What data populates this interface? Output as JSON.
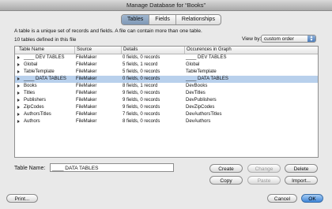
{
  "window": {
    "title": "Manage Database for “Books”"
  },
  "tabs": [
    {
      "label": "Tables",
      "active": true
    },
    {
      "label": "Fields",
      "active": false
    },
    {
      "label": "Relationships",
      "active": false
    }
  ],
  "description": "A table is a unique set of records and fields. A file can contain more than one table.",
  "table_count": "10 tables defined in this file",
  "view_by": {
    "label": "View by:",
    "value": "custom order"
  },
  "table_list": {
    "headers": [
      "Table Name",
      "Source",
      "Details",
      "Occurences in Graph"
    ],
    "rows": [
      {
        "name": "____ DEV TABLES",
        "source": "FileMaker",
        "details": "0 fields, 0 records",
        "occurrences": "____ DEV TABLES",
        "selected": false
      },
      {
        "name": "Global",
        "source": "FileMaker",
        "details": "5 fields, 1 record",
        "occurrences": "Global",
        "selected": false
      },
      {
        "name": "TableTemplate",
        "source": "FileMaker",
        "details": "5 fields, 0 records",
        "occurrences": "TableTemplate",
        "selected": false
      },
      {
        "name": "____ DATA TABLES",
        "source": "FileMaker",
        "details": "0 fields, 0 records",
        "occurrences": "____ DATA TABLES",
        "selected": true
      },
      {
        "name": "Books",
        "source": "FileMaker",
        "details": "8 fields, 1 record",
        "occurrences": "DevBooks",
        "selected": false
      },
      {
        "name": "Titles",
        "source": "FileMaker",
        "details": "9 fields, 0 records",
        "occurrences": "DevTitles",
        "selected": false
      },
      {
        "name": "Publishers",
        "source": "FileMaker",
        "details": "9 fields, 0 records",
        "occurrences": "DevPublishers",
        "selected": false
      },
      {
        "name": "ZipCodes",
        "source": "FileMaker",
        "details": "9 fields, 0 records",
        "occurrences": "DevZipCodes",
        "selected": false
      },
      {
        "name": "AuthorsTitles",
        "source": "FileMaker",
        "details": "7 fields, 0 records",
        "occurrences": "DevAuthorsTitles",
        "selected": false
      },
      {
        "name": "Authors",
        "source": "FileMaker",
        "details": "8 fields, 0 records",
        "occurrences": "DevAuthors",
        "selected": false
      }
    ]
  },
  "table_name": {
    "label": "Table Name:",
    "value": "____ DATA TABLES"
  },
  "buttons": {
    "create": "Create",
    "change": "Change",
    "delete": "Delete",
    "copy": "Copy",
    "paste": "Paste",
    "import": "Import...",
    "print": "Print...",
    "cancel": "Cancel",
    "ok": "OK"
  },
  "colors": {
    "selection": "#b8d0ec",
    "accent": "#3d85d8"
  }
}
